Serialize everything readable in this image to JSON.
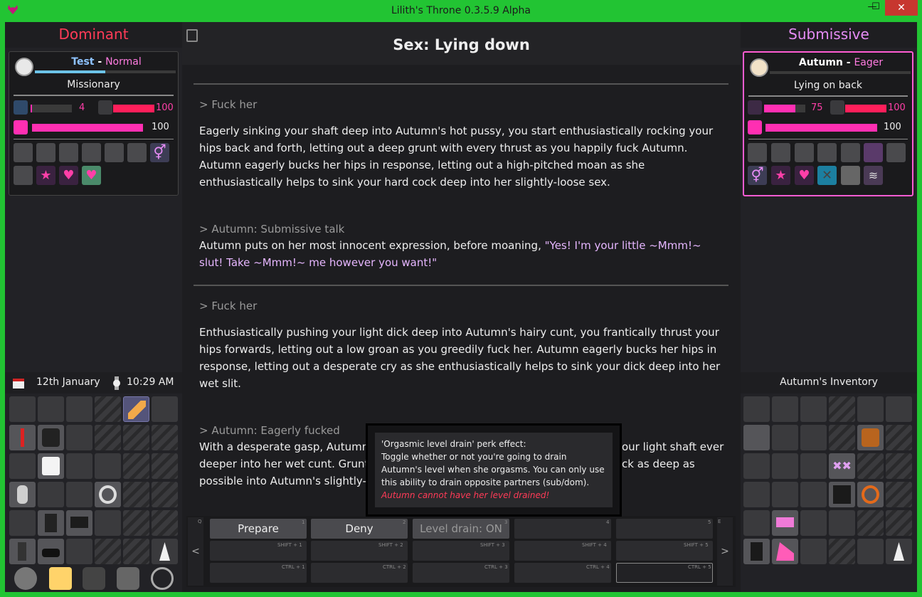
{
  "window": {
    "title": "Lilith's Throne 0.3.5.9 Alpha",
    "minimize": "—",
    "maximize": "☐",
    "close": "✕"
  },
  "colors": {
    "accent": "#22c433",
    "dominant": "#ff3b57",
    "submissive": "#e68cf5",
    "pink_bar": "#ff2fb2",
    "tooltip_warning": "#ff3b57"
  },
  "left": {
    "header": "Dominant",
    "card": {
      "name": "Test",
      "separator": " - ",
      "mood": "Normal",
      "xp_fraction": 0.5,
      "position": "Missionary",
      "arousal": {
        "value": "4",
        "fraction": 0.04
      },
      "lust": {
        "value": "100",
        "fraction": 1.0
      },
      "love": {
        "value": "100",
        "fraction": 1.0
      }
    },
    "date": "12th January",
    "time": "10:29 AM"
  },
  "center": {
    "title": "Sex: Lying down",
    "log": [
      {
        "action": "> Fuck her",
        "text": "Eagerly sinking your shaft deep into Autumn's hot pussy, you start enthusiastically rocking your hips back and forth, letting out a deep grunt with every thrust as you happily fuck Autumn. Autumn eagerly bucks her hips in response, letting out a high-pitched moan as she enthusiastically helps to sink your hard cock deep into her slightly-loose sex."
      },
      {
        "action": "> Autumn: Submissive talk",
        "text": "Autumn puts on her most innocent expression, before moaning, ",
        "speech": "\"Yes! I'm your little ~Mmm!~ slut! Take ~Mmm!~ me however you want!\""
      },
      {
        "action": "> Fuck her",
        "text": "Enthusiastically pushing your light dick deep into Autumn's hairy cunt, you frantically thrust your hips forwards, letting out a low groan as you greedily fuck her. Autumn eagerly bucks her hips in response, letting out a desperate cry as she enthusiastically helps to sink your dick deep into her wet slit."
      },
      {
        "action": "> Autumn: Eagerly fucked",
        "text_a": "With a desperate gasp, Autumn",
        "text_b": "our light shaft ever",
        "text_c": "deeper into her wet cunt. Grunt",
        "text_d": "ck as deep as",
        "text_e": "possible into Autumn's slightly-l"
      }
    ],
    "tooltip": {
      "title": "'Orgasmic level drain' perk effect:",
      "body": "Toggle whether or not you're going to drain Autumn's level when she orgasms. You can only use this ability to drain opposite partners (sub/dom).",
      "warning": "Autumn cannot have her level drained!"
    },
    "actions": {
      "row1": [
        "Prepare",
        "Deny",
        "Level drain: ON",
        "",
        ""
      ],
      "row1_keys": [
        "1",
        "2",
        "3",
        "4",
        "5"
      ],
      "row2_keys": [
        "SHIFT + 1",
        "SHIFT + 2",
        "SHIFT + 3",
        "SHIFT + 4",
        "SHIFT + 5"
      ],
      "row3_keys": [
        "CTRL + 1",
        "CTRL + 2",
        "CTRL + 3",
        "CTRL + 4",
        "CTRL + 5"
      ],
      "prev_key": "Q",
      "next_key": "E",
      "prev": "<",
      "next": ">"
    }
  },
  "right": {
    "header": "Submissive",
    "card": {
      "name": "Autumn",
      "separator": " - ",
      "mood": "Eager",
      "xp_fraction": 0.0,
      "position": "Lying on back",
      "arousal": {
        "value": "75",
        "fraction": 0.75
      },
      "lust": {
        "value": "100",
        "fraction": 1.0
      },
      "love": {
        "value": "100",
        "fraction": 1.0
      }
    },
    "inventory_title": "Autumn's Inventory"
  }
}
